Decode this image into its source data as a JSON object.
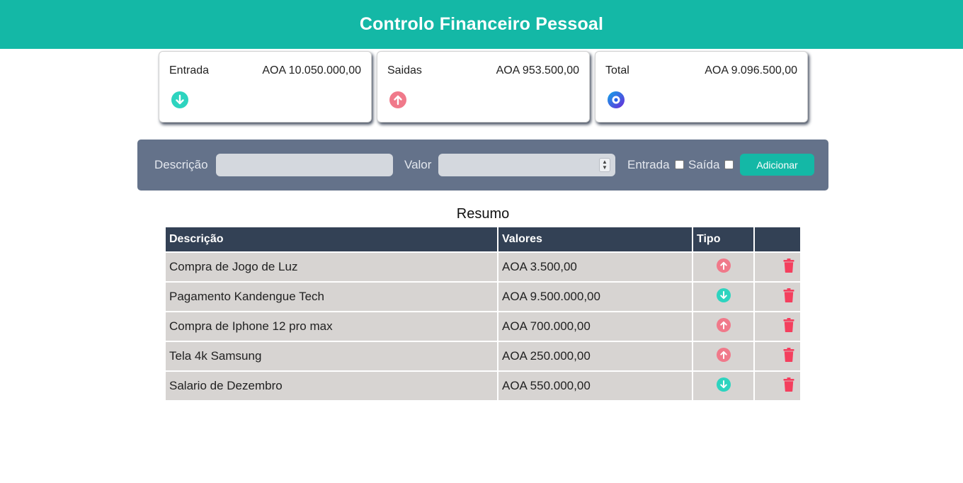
{
  "header": {
    "title": "Controlo Financeiro Pessoal"
  },
  "cards": {
    "entrada": {
      "label": "Entrada",
      "value": "AOA 10.050.000,00",
      "icon": "arrow-down-circle-icon",
      "color": "#2dd4bf"
    },
    "saidas": {
      "label": "Saidas",
      "value": "AOA 953.500,00",
      "icon": "arrow-up-circle-icon",
      "color": "#f0798a"
    },
    "total": {
      "label": "Total",
      "value": "AOA 9.096.500,00",
      "icon": "circle-dot-icon",
      "color": "#0ea5e9"
    }
  },
  "form": {
    "descricao_label": "Descrição",
    "descricao_value": "",
    "valor_label": "Valor",
    "valor_value": "",
    "entrada_label": "Entrada",
    "saida_label": "Saída",
    "add_button": "Adicionar"
  },
  "resumo": {
    "title": "Resumo",
    "columns": [
      "Descrição",
      "Valores",
      "Tipo",
      ""
    ],
    "rows": [
      {
        "descricao": "Compra de Jogo de Luz",
        "valor": "AOA 3.500,00",
        "tipo": "saida"
      },
      {
        "descricao": "Pagamento Kandengue Tech",
        "valor": "AOA 9.500.000,00",
        "tipo": "entrada"
      },
      {
        "descricao": "Compra de Iphone 12 pro max",
        "valor": "AOA 700.000,00",
        "tipo": "saida"
      },
      {
        "descricao": "Tela 4k Samsung",
        "valor": "AOA 250.000,00",
        "tipo": "saida"
      },
      {
        "descricao": "Salario de Dezembro",
        "valor": "AOA 550.000,00",
        "tipo": "entrada"
      }
    ]
  },
  "colors": {
    "brand": "#14b8a6",
    "form_bg": "#64728a",
    "table_header": "#334155",
    "table_cell": "#d7d4d2",
    "delete": "#f43f5e",
    "entrada": "#2dd4bf",
    "saida": "#f0798a"
  }
}
